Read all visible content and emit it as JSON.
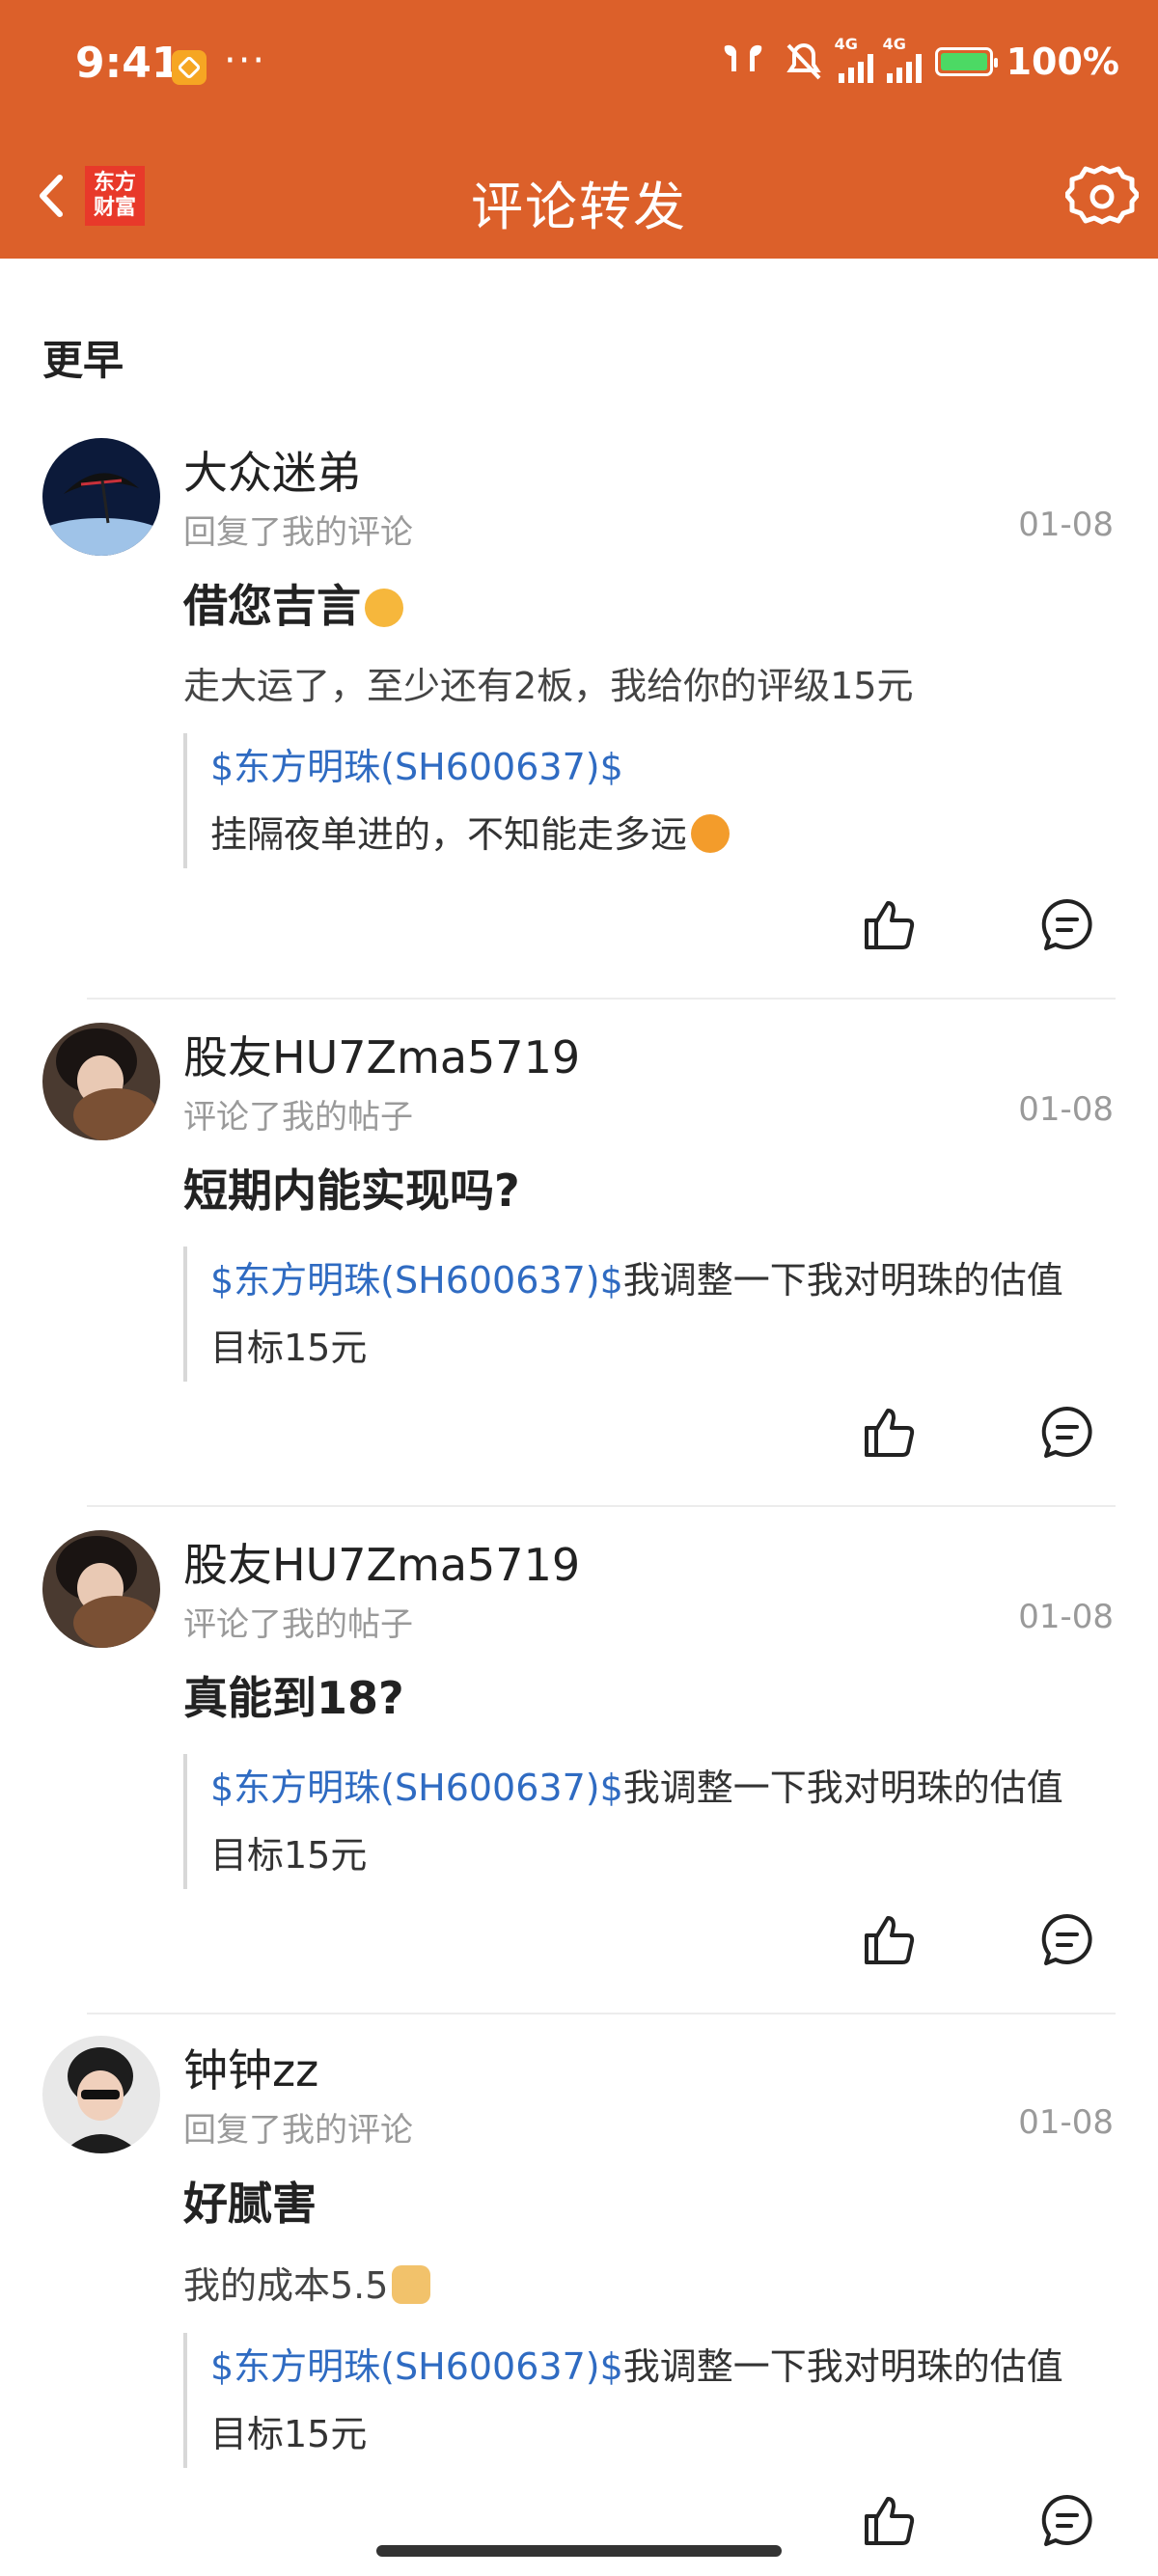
{
  "status_bar": {
    "time": "9:41",
    "dots": "···",
    "net1": "4G",
    "net2": "4G",
    "battery": "100%"
  },
  "nav": {
    "logo_line1": "东方",
    "logo_line2": "财富",
    "title": "评论转发"
  },
  "section_label": "更早",
  "comments": [
    {
      "user": "大众迷弟",
      "action": "回复了我的评论",
      "date": "01-08",
      "reply": "借您吉言",
      "reply_extra": "走大运了，至少还有2板，我给你的评级15元",
      "quote_tag": "$东方明珠(SH600637)$",
      "quote_text": "挂隔夜单进的，不知能走多远"
    },
    {
      "user": "股友HU7Zma5719",
      "action": "评论了我的帖子",
      "date": "01-08",
      "reply": "短期内能实现吗?",
      "quote_tag": "$东方明珠(SH600637)$",
      "quote_text": "我调整一下我对明珠的估值目标15元"
    },
    {
      "user": "股友HU7Zma5719",
      "action": "评论了我的帖子",
      "date": "01-08",
      "reply": "真能到18?",
      "quote_tag": "$东方明珠(SH600637)$",
      "quote_text": "我调整一下我对明珠的估值目标15元"
    },
    {
      "user": "钟钟zz",
      "action": "回复了我的评论",
      "date": "01-08",
      "reply": "好腻害",
      "reply_extra": "我的成本5.5",
      "quote_tag": "$东方明珠(SH600637)$",
      "quote_text": "我调整一下我对明珠的估值目标15元"
    }
  ],
  "colors": {
    "header": "#dc602a",
    "tag": "#2f6bc2"
  }
}
